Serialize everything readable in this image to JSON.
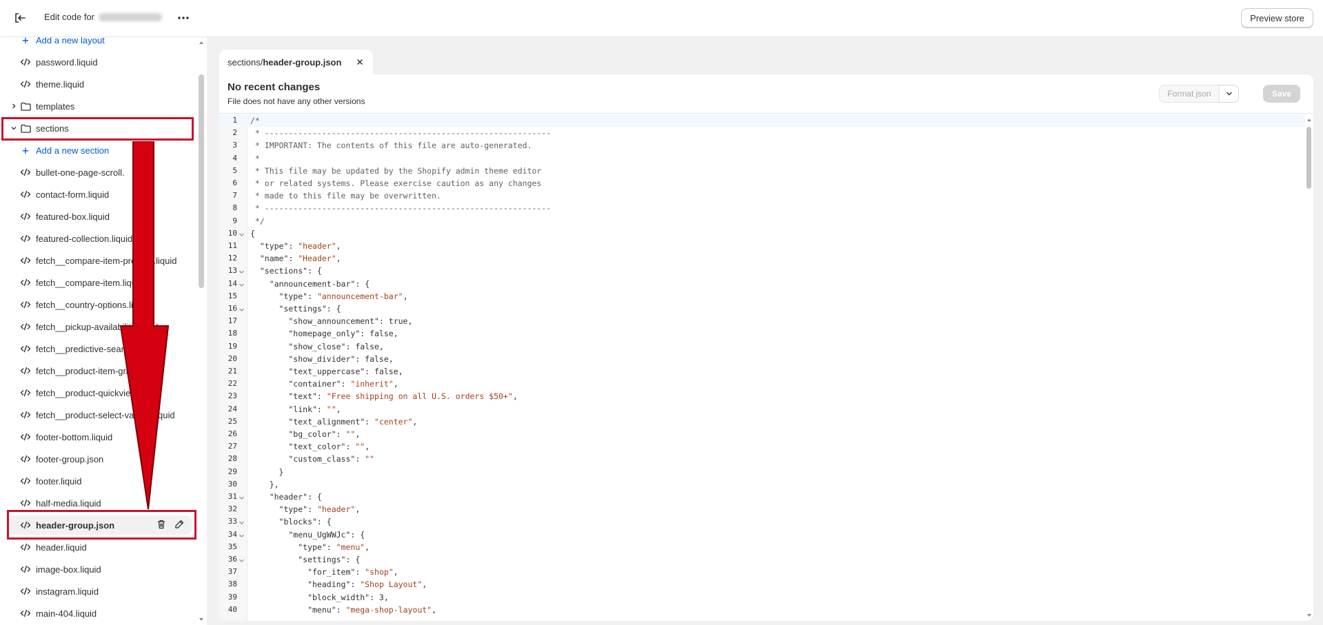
{
  "topbar": {
    "title_prefix": "Edit code for",
    "preview_label": "Preview store"
  },
  "sidebar": {
    "rows": [
      {
        "label": "Add a new layout",
        "kind": "add"
      },
      {
        "label": "password.liquid",
        "kind": "file"
      },
      {
        "label": "theme.liquid",
        "kind": "file"
      },
      {
        "label": "templates",
        "kind": "folder",
        "expanded": false
      },
      {
        "label": "sections",
        "kind": "folder",
        "expanded": true
      },
      {
        "label": "Add a new section",
        "kind": "add"
      },
      {
        "label": "bullet-one-page-scroll.",
        "kind": "file"
      },
      {
        "label": "contact-form.liquid",
        "kind": "file"
      },
      {
        "label": "featured-box.liquid",
        "kind": "file"
      },
      {
        "label": "featured-collection.liquid",
        "kind": "file"
      },
      {
        "label": "fetch__compare-item-preview.liquid",
        "kind": "file"
      },
      {
        "label": "fetch__compare-item.liquid",
        "kind": "file"
      },
      {
        "label": "fetch__country-options.liquid",
        "kind": "file"
      },
      {
        "label": "fetch__pickup-availability.liquid",
        "kind": "file"
      },
      {
        "label": "fetch__predictive-search.liquid",
        "kind": "file"
      },
      {
        "label": "fetch__product-item-grid.liquid",
        "kind": "file"
      },
      {
        "label": "fetch__product-quickview.liquid",
        "kind": "file"
      },
      {
        "label": "fetch__product-select-variant.liquid",
        "kind": "file"
      },
      {
        "label": "footer-bottom.liquid",
        "kind": "file"
      },
      {
        "label": "footer-group.json",
        "kind": "file"
      },
      {
        "label": "footer.liquid",
        "kind": "file"
      },
      {
        "label": "half-media.liquid",
        "kind": "file"
      },
      {
        "label": "header-group.json",
        "kind": "file",
        "active": true
      },
      {
        "label": "header.liquid",
        "kind": "file"
      },
      {
        "label": "image-box.liquid",
        "kind": "file"
      },
      {
        "label": "instagram.liquid",
        "kind": "file"
      },
      {
        "label": "main-404.liquid",
        "kind": "file"
      }
    ]
  },
  "tab": {
    "dir": "sections/",
    "file": "header-group.json"
  },
  "editor": {
    "history_title": "No recent changes",
    "history_sub": "File does not have any other versions",
    "format_label": "Format json",
    "save_label": "Save",
    "lines": [
      "/*",
      " * ------------------------------------------------------------",
      " * IMPORTANT: The contents of this file are auto-generated.",
      " *",
      " * This file may be updated by the Shopify admin theme editor",
      " * or related systems. Please exercise caution as any changes",
      " * made to this file may be overwritten.",
      " * ------------------------------------------------------------",
      " */",
      "{",
      "  \"type\": \"header\",",
      "  \"name\": \"Header\",",
      "  \"sections\": {",
      "    \"announcement-bar\": {",
      "      \"type\": \"announcement-bar\",",
      "      \"settings\": {",
      "        \"show_announcement\": true,",
      "        \"homepage_only\": false,",
      "        \"show_close\": false,",
      "        \"show_divider\": false,",
      "        \"text_uppercase\": false,",
      "        \"container\": \"inherit\",",
      "        \"text\": \"Free shipping on all U.S. orders $50+\",",
      "        \"link\": \"\",",
      "        \"text_alignment\": \"center\",",
      "        \"bg_color\": \"\",",
      "        \"text_color\": \"\",",
      "        \"custom_class\": \"\"",
      "      }",
      "    },",
      "    \"header\": {",
      "      \"type\": \"header\",",
      "      \"blocks\": {",
      "        \"menu_UgWWJc\": {",
      "          \"type\": \"menu\",",
      "          \"settings\": {",
      "            \"for_item\": \"shop\",",
      "            \"heading\": \"Shop Layout\",",
      "            \"block_width\": 3,",
      "            \"menu\": \"mega-shop-layout\","
    ],
    "foldable_lines": [
      10,
      13,
      14,
      16,
      31,
      33,
      34,
      36
    ],
    "current_line": 1
  },
  "colors": {
    "highlight": "#c8102e",
    "link": "#005bd3",
    "string": "#a3401a"
  }
}
